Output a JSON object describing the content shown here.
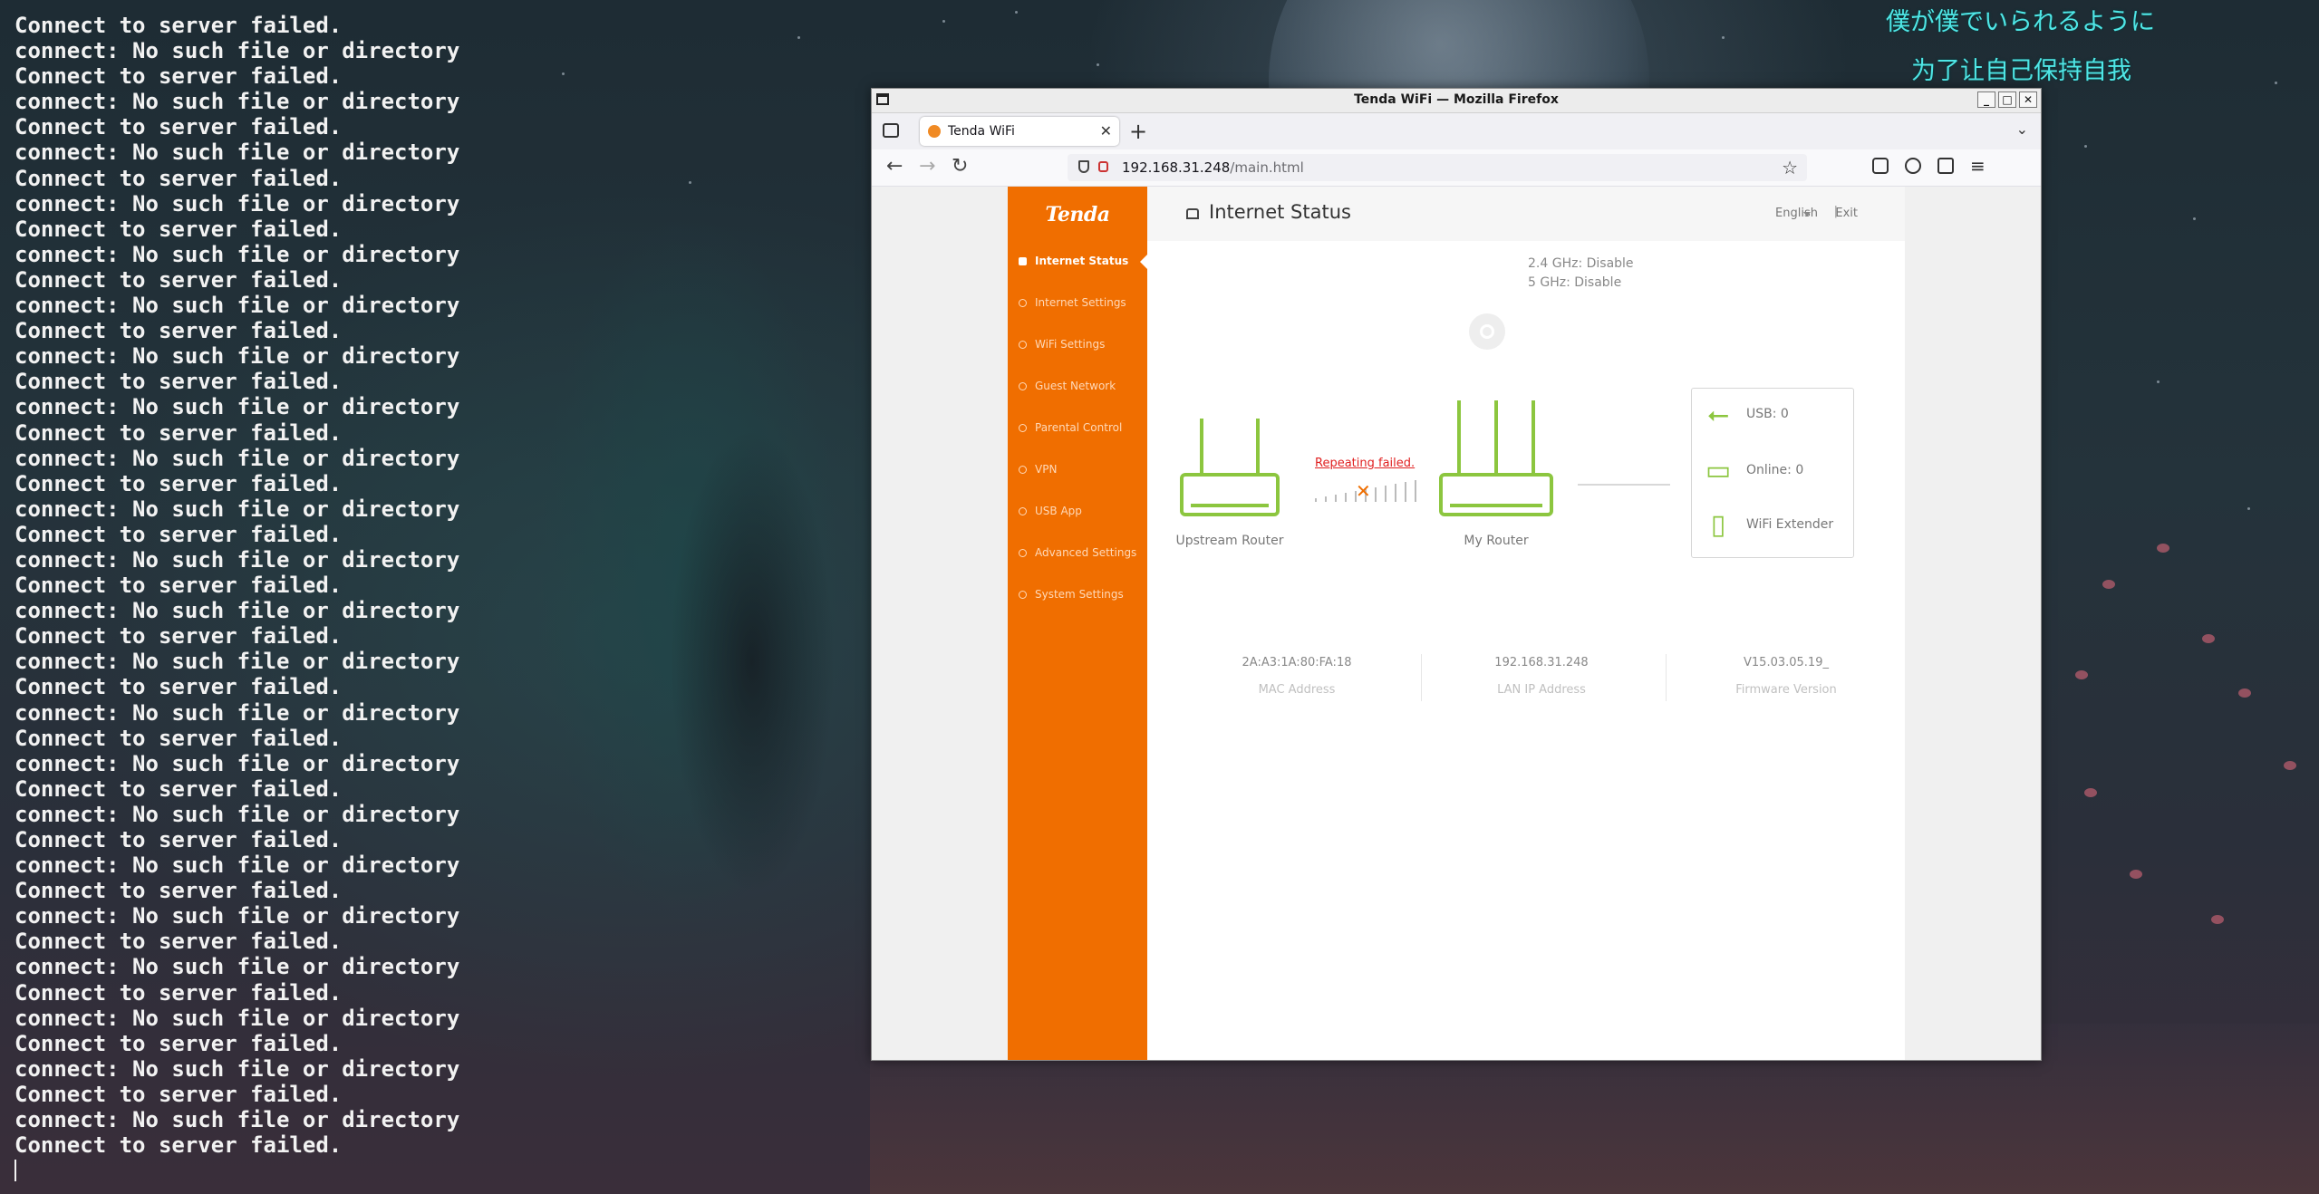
{
  "terminal": {
    "lines": [
      "Connect to server failed.",
      "connect: No such file or directory",
      "Connect to server failed.",
      "connect: No such file or directory",
      "Connect to server failed.",
      "connect: No such file or directory",
      "Connect to server failed.",
      "connect: No such file or directory",
      "Connect to server failed.",
      "connect: No such file or directory",
      "Connect to server failed.",
      "connect: No such file or directory",
      "Connect to server failed.",
      "connect: No such file or directory",
      "Connect to server failed.",
      "connect: No such file or directory",
      "Connect to server failed.",
      "connect: No such file or directory",
      "Connect to server failed.",
      "connect: No such file or directory",
      "Connect to server failed.",
      "connect: No such file or directory",
      "Connect to server failed.",
      "connect: No such file or directory",
      "Connect to server failed.",
      "connect: No such file or directory",
      "Connect to server failed.",
      "connect: No such file or directory",
      "Connect to server failed.",
      "connect: No such file or directory",
      "Connect to server failed.",
      "connect: No such file or directory",
      "Connect to server failed.",
      "connect: No such file or directory",
      "Connect to server failed.",
      "connect: No such file or directory",
      "Connect to server failed.",
      "connect: No such file or directory",
      "Connect to server failed.",
      "connect: No such file or directory",
      "Connect to server failed.",
      "connect: No such file or directory",
      "Connect to server failed.",
      "connect: No such file or directory",
      "Connect to server failed."
    ]
  },
  "lyrics": {
    "line1": "僕が僕でいられるように",
    "line2": "为了让自己保持自我"
  },
  "window": {
    "title": "Tenda WiFi — Mozilla Firefox",
    "minimize": "_",
    "maximize": "□",
    "close": "✕"
  },
  "browser": {
    "tab_title": "Tenda WiFi",
    "tab_close": "✕",
    "new_tab": "+",
    "tab_list": "⌄",
    "back": "←",
    "forward": "→",
    "reload": "↻",
    "url_host": "192.168.31.248",
    "url_path": "/main.html",
    "bookmark": "☆",
    "menu": "≡"
  },
  "app": {
    "logo": "Tenda",
    "page_title": "Internet Status",
    "language": "English",
    "separator": "|",
    "exit": "Exit",
    "menu": [
      {
        "label": "Internet Status",
        "icon": "internet-status-icon"
      },
      {
        "label": "Internet Settings",
        "icon": "globe-icon"
      },
      {
        "label": "WiFi Settings",
        "icon": "wifi-icon"
      },
      {
        "label": "Guest Network",
        "icon": "guest-network-icon"
      },
      {
        "label": "Parental Control",
        "icon": "parental-control-icon"
      },
      {
        "label": "VPN",
        "icon": "vpn-icon"
      },
      {
        "label": "USB App",
        "icon": "usb-icon"
      },
      {
        "label": "Advanced Settings",
        "icon": "wrench-icon"
      },
      {
        "label": "System Settings",
        "icon": "gear-icon"
      }
    ],
    "bands": {
      "ghz24": "2.4 GHz: Disable",
      "ghz5": "5 GHz: Disable"
    },
    "upstream_label": "Upstream Router",
    "my_router_label": "My Router",
    "repeat_status": "Repeating failed.",
    "devices": {
      "usb": "USB:  0",
      "online": "Online:  0",
      "extender": "WiFi Extender"
    },
    "info": {
      "mac_value": "2A:A3:1A:80:FA:18",
      "mac_label": "MAC Address",
      "lan_value": "192.168.31.248",
      "lan_label": "LAN IP Address",
      "fw_value": "V15.03.05.19_",
      "fw_label": "Firmware Version"
    }
  },
  "colors": {
    "tenda_orange": "#f06e00",
    "router_green": "#8cc63f",
    "error_red": "#e02020",
    "lyric_cyan": "#4fe6e6"
  }
}
